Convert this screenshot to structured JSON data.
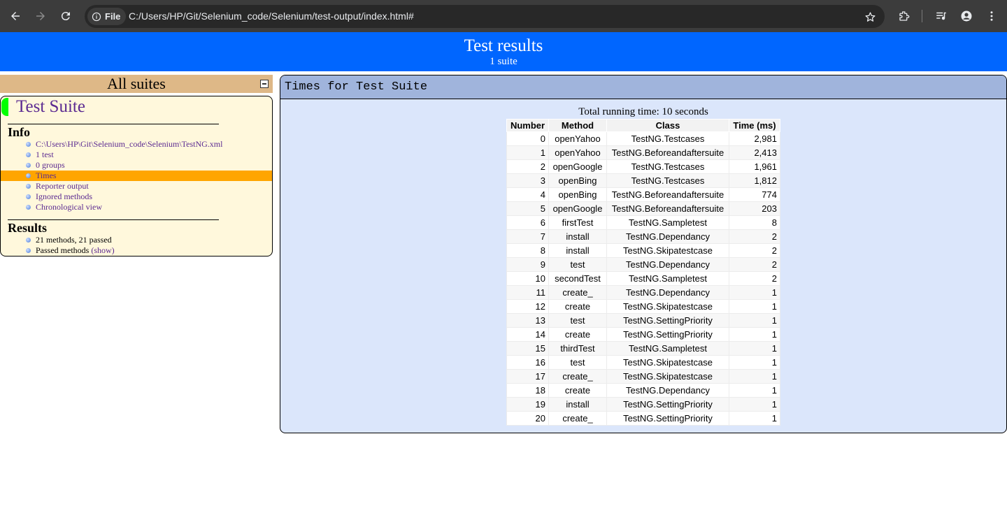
{
  "browser": {
    "site_chip_label": "File",
    "url": "C:/Users/HP/Git/Selenium_code/Selenium/test-output/index.html#"
  },
  "banner": {
    "title": "Test results",
    "subtitle": "1 suite"
  },
  "navigator": {
    "header": "All suites",
    "suite_name": "Test Suite",
    "info_heading": "Info",
    "info_items": [
      {
        "label": "C:\\Users\\HP\\Git\\Selenium_code\\Selenium\\TestNG.xml"
      },
      {
        "label": "1 test"
      },
      {
        "label": "0 groups"
      },
      {
        "label": "Times"
      },
      {
        "label": "Reporter output"
      },
      {
        "label": "Ignored methods"
      },
      {
        "label": "Chronological view"
      }
    ],
    "results_heading": "Results",
    "results_items": {
      "summary": "21 methods, 21 passed",
      "passed_label": "Passed methods",
      "show_link": "(show)"
    }
  },
  "times_panel": {
    "header": "Times for Test Suite",
    "total_running_time": "Total running time: 10 seconds",
    "columns": [
      "Number",
      "Method",
      "Class",
      "Time (ms)"
    ],
    "rows": [
      {
        "number": "0",
        "method": "openYahoo",
        "class": "TestNG.Testcases",
        "time": "2,981"
      },
      {
        "number": "1",
        "method": "openYahoo",
        "class": "TestNG.Beforeandaftersuite",
        "time": "2,413"
      },
      {
        "number": "2",
        "method": "openGoogle",
        "class": "TestNG.Testcases",
        "time": "1,961"
      },
      {
        "number": "3",
        "method": "openBing",
        "class": "TestNG.Testcases",
        "time": "1,812"
      },
      {
        "number": "4",
        "method": "openBing",
        "class": "TestNG.Beforeandaftersuite",
        "time": "774"
      },
      {
        "number": "5",
        "method": "openGoogle",
        "class": "TestNG.Beforeandaftersuite",
        "time": "203"
      },
      {
        "number": "6",
        "method": "firstTest",
        "class": "TestNG.Sampletest",
        "time": "8"
      },
      {
        "number": "7",
        "method": "install",
        "class": "TestNG.Dependancy",
        "time": "2"
      },
      {
        "number": "8",
        "method": "install",
        "class": "TestNG.Skipatestcase",
        "time": "2"
      },
      {
        "number": "9",
        "method": "test",
        "class": "TestNG.Dependancy",
        "time": "2"
      },
      {
        "number": "10",
        "method": "secondTest",
        "class": "TestNG.Sampletest",
        "time": "2"
      },
      {
        "number": "11",
        "method": "create_",
        "class": "TestNG.Dependancy",
        "time": "1"
      },
      {
        "number": "12",
        "method": "create",
        "class": "TestNG.Skipatestcase",
        "time": "1"
      },
      {
        "number": "13",
        "method": "test",
        "class": "TestNG.SettingPriority",
        "time": "1"
      },
      {
        "number": "14",
        "method": "create",
        "class": "TestNG.SettingPriority",
        "time": "1"
      },
      {
        "number": "15",
        "method": "thirdTest",
        "class": "TestNG.Sampletest",
        "time": "1"
      },
      {
        "number": "16",
        "method": "test",
        "class": "TestNG.Skipatestcase",
        "time": "1"
      },
      {
        "number": "17",
        "method": "create_",
        "class": "TestNG.Skipatestcase",
        "time": "1"
      },
      {
        "number": "18",
        "method": "create",
        "class": "TestNG.Dependancy",
        "time": "1"
      },
      {
        "number": "19",
        "method": "install",
        "class": "TestNG.SettingPriority",
        "time": "1"
      },
      {
        "number": "20",
        "method": "create_",
        "class": "TestNG.SettingPriority",
        "time": "1"
      }
    ]
  },
  "colors": {
    "banner": "#0066ff",
    "suites_header": "#deb887",
    "suite_panel": "#fff8dc",
    "selected_item": "#ffa500",
    "times_panel": "#dbe6fb",
    "times_header": "#a0b4dc",
    "suite_marker": "#00ff00"
  }
}
